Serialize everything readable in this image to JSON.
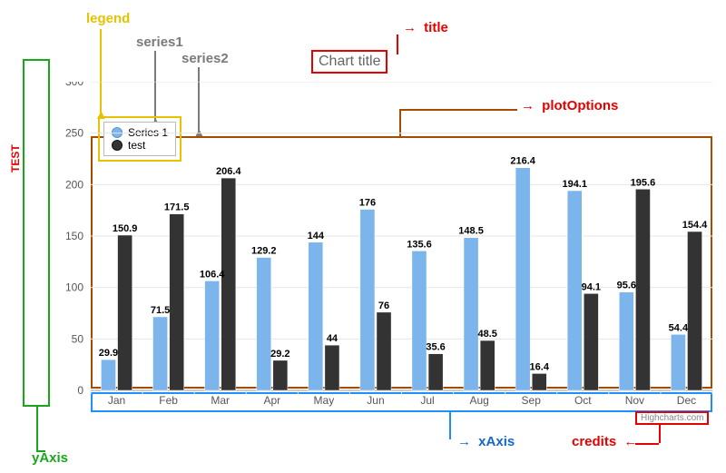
{
  "annotations": {
    "legend": "legend",
    "series1": "series1",
    "series2": "series2",
    "title_label": "title",
    "plotOptions": "plotOptions",
    "xAxis": "xAxis",
    "yAxis": "yAxis",
    "credits": "credits"
  },
  "title_box": "Chart title",
  "yaxis_title": "TEST",
  "credits_text": "Highcharts.com",
  "legend": {
    "series1_label": "Series 1",
    "series2_label": "test"
  },
  "chart_data": {
    "type": "bar",
    "title": "Chart title",
    "xlabel": "",
    "ylabel": "TEST",
    "ylim": [
      0,
      300
    ],
    "yticks": [
      0,
      50,
      100,
      150,
      200,
      250,
      300
    ],
    "categories": [
      "Jan",
      "Feb",
      "Mar",
      "Apr",
      "May",
      "Jun",
      "Jul",
      "Aug",
      "Sep",
      "Oct",
      "Nov",
      "Dec"
    ],
    "series": [
      {
        "name": "Series 1",
        "color": "#7cb5ec",
        "values": [
          29.9,
          71.5,
          106.4,
          129.2,
          144,
          176,
          135.6,
          148.5,
          216.4,
          194.1,
          95.6,
          54.4
        ]
      },
      {
        "name": "test",
        "color": "#333333",
        "values": [
          150.9,
          171.5,
          206.4,
          29.2,
          44,
          76,
          35.6,
          48.5,
          16.4,
          94.1,
          195.6,
          154.4
        ]
      }
    ]
  }
}
